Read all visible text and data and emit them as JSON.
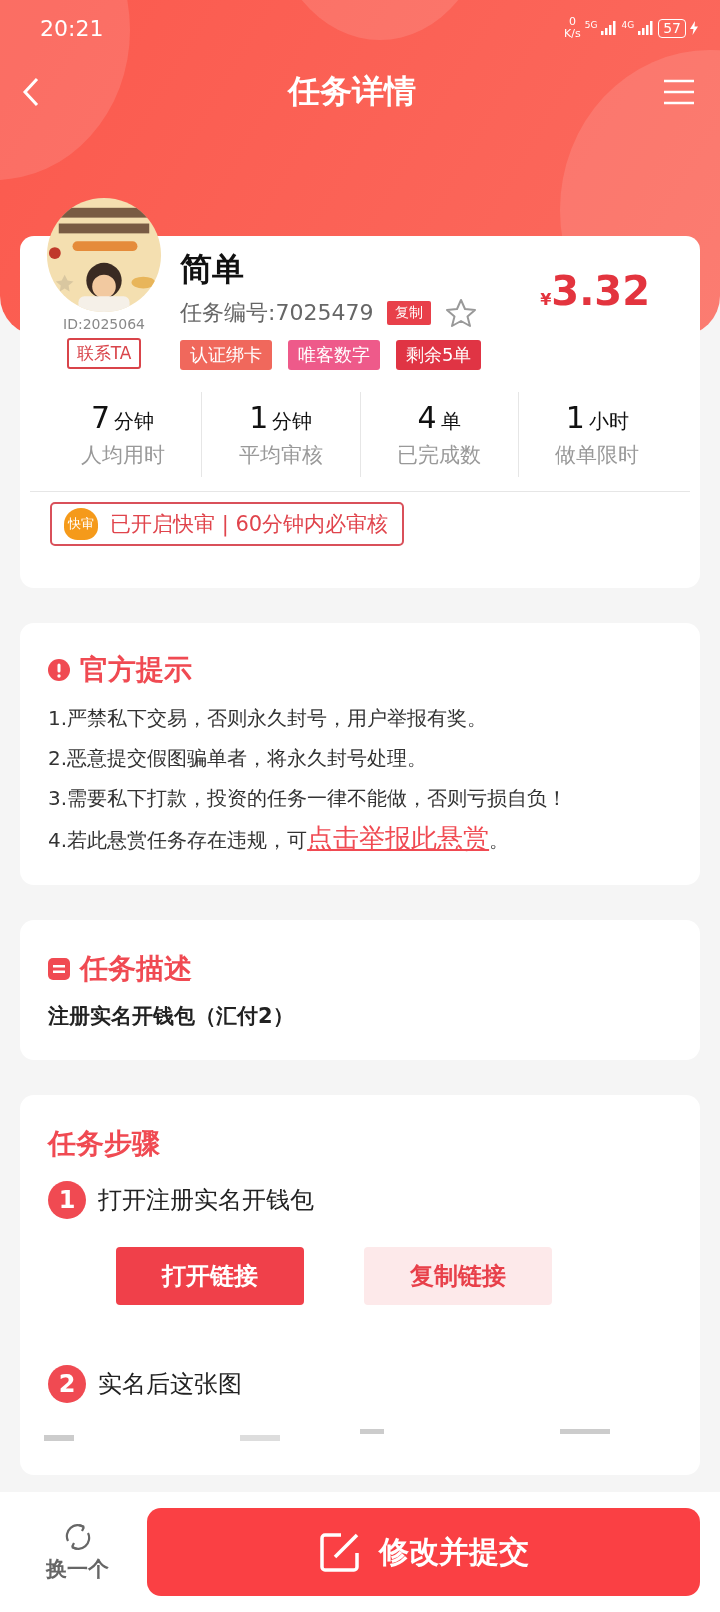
{
  "status_bar": {
    "time": "20:21",
    "net_speed": "0",
    "net_unit": "K/s",
    "network_1": "5G",
    "network_2": "4G",
    "battery": "57"
  },
  "header": {
    "title": "任务详情"
  },
  "task": {
    "user_id": "ID:2025064",
    "contact_button": "联系TA",
    "title": "简单",
    "number": "任务编号:7025479",
    "copy_button": "复制",
    "favorited": false,
    "price_symbol": "¥",
    "price": "3.32",
    "tags": [
      {
        "label": "认证绑卡",
        "color": "#f0685c"
      },
      {
        "label": "唯客数字",
        "color": "#ee5a8a"
      },
      {
        "label": "剩余5单",
        "color": "#e03444"
      }
    ],
    "stats": [
      {
        "value": "7",
        "unit": "分钟",
        "label": "人均用时"
      },
      {
        "value": "1",
        "unit": "分钟",
        "label": "平均审核"
      },
      {
        "value": "4",
        "unit": "单",
        "label": "已完成数"
      },
      {
        "value": "1",
        "unit": "小时",
        "label": "做单限时"
      }
    ],
    "fast_review": {
      "badge": "快审",
      "text": "已开启快审 | 60分钟内必审核"
    }
  },
  "notice": {
    "title": "官方提示",
    "items": [
      "1.严禁私下交易，否则永久封号，用户举报有奖。",
      "2.恶意提交假图骗单者，将永久封号处理。",
      "3.需要私下打款，投资的任务一律不能做，否则亏损自负！"
    ],
    "report_prefix": "4.若此悬赏任务存在违规，可",
    "report_link": "点击举报此悬赏",
    "report_suffix": "。"
  },
  "description": {
    "title": "任务描述",
    "text": "注册实名开钱包（汇付2）"
  },
  "steps": {
    "title": "任务步骤",
    "items": [
      {
        "number": "1",
        "text": "打开注册实名开钱包",
        "kind": "buttons",
        "buttons": [
          {
            "label": "打开链接",
            "kind": "primary"
          },
          {
            "label": "复制链接",
            "kind": "secondary"
          }
        ]
      },
      {
        "number": "2",
        "text": "实名后这张图",
        "kind": "images"
      }
    ]
  },
  "bottom_bar": {
    "switch_button": "换一个",
    "submit_button": "修改并提交"
  }
}
